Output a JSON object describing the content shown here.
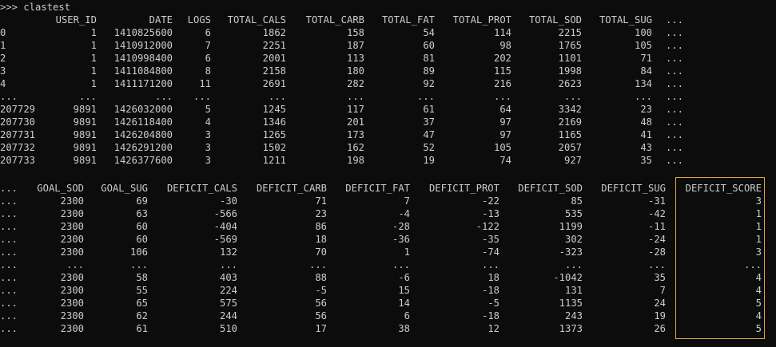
{
  "console": {
    "prompt_line": ">>> clastest",
    "highlight_color": "#e3a336",
    "block1": {
      "headers": [
        "",
        "USER_ID",
        "DATE",
        "LOGS",
        "TOTAL_CALS",
        "TOTAL_CARB",
        "TOTAL_FAT",
        "TOTAL_PROT",
        "TOTAL_SOD",
        "TOTAL_SUG",
        "..."
      ],
      "rows": [
        [
          "0",
          "1",
          "1410825600",
          "6",
          "1862",
          "158",
          "54",
          "114",
          "2215",
          "100",
          "..."
        ],
        [
          "1",
          "1",
          "1410912000",
          "7",
          "2251",
          "187",
          "60",
          "98",
          "1765",
          "105",
          "..."
        ],
        [
          "2",
          "1",
          "1410998400",
          "6",
          "2001",
          "113",
          "81",
          "202",
          "1101",
          "71",
          "..."
        ],
        [
          "3",
          "1",
          "1411084800",
          "8",
          "2158",
          "180",
          "89",
          "115",
          "1998",
          "84",
          "..."
        ],
        [
          "4",
          "1",
          "1411171200",
          "11",
          "2691",
          "282",
          "92",
          "216",
          "2623",
          "134",
          "..."
        ],
        [
          "...",
          "...",
          "...",
          "...",
          "...",
          "...",
          "...",
          "...",
          "...",
          "...",
          "..."
        ],
        [
          "207729",
          "9891",
          "1426032000",
          "5",
          "1245",
          "117",
          "61",
          "64",
          "3342",
          "23",
          "..."
        ],
        [
          "207730",
          "9891",
          "1426118400",
          "4",
          "1346",
          "201",
          "37",
          "97",
          "2169",
          "48",
          "..."
        ],
        [
          "207731",
          "9891",
          "1426204800",
          "3",
          "1265",
          "173",
          "47",
          "97",
          "1165",
          "41",
          "..."
        ],
        [
          "207732",
          "9891",
          "1426291200",
          "3",
          "1502",
          "162",
          "52",
          "105",
          "2057",
          "43",
          "..."
        ],
        [
          "207733",
          "9891",
          "1426377600",
          "3",
          "1211",
          "198",
          "19",
          "74",
          "927",
          "35",
          "..."
        ]
      ]
    },
    "block2": {
      "headers": [
        "...",
        "GOAL_SOD",
        "GOAL_SUG",
        "DEFICIT_CALS",
        "DEFICIT_CARB",
        "DEFICIT_FAT",
        "DEFICIT_PROT",
        "DEFICIT_SOD",
        "DEFICIT_SUG",
        "DEFICIT_SCORE"
      ],
      "rows": [
        [
          "...",
          "2300",
          "69",
          "-30",
          "71",
          "7",
          "-22",
          "85",
          "-31",
          "3"
        ],
        [
          "...",
          "2300",
          "63",
          "-566",
          "23",
          "-4",
          "-13",
          "535",
          "-42",
          "1"
        ],
        [
          "...",
          "2300",
          "60",
          "-404",
          "86",
          "-28",
          "-122",
          "1199",
          "-11",
          "1"
        ],
        [
          "...",
          "2300",
          "60",
          "-569",
          "18",
          "-36",
          "-35",
          "302",
          "-24",
          "1"
        ],
        [
          "...",
          "2300",
          "106",
          "132",
          "70",
          "1",
          "-74",
          "-323",
          "-28",
          "3"
        ],
        [
          "...",
          "...",
          "...",
          "...",
          "...",
          "...",
          "...",
          "...",
          "...",
          "..."
        ],
        [
          "...",
          "2300",
          "58",
          "403",
          "88",
          "-6",
          "18",
          "-1042",
          "35",
          "4"
        ],
        [
          "...",
          "2300",
          "55",
          "224",
          "-5",
          "15",
          "-18",
          "131",
          "7",
          "4"
        ],
        [
          "...",
          "2300",
          "65",
          "575",
          "56",
          "14",
          "-5",
          "1135",
          "24",
          "5"
        ],
        [
          "...",
          "2300",
          "62",
          "244",
          "56",
          "6",
          "-18",
          "243",
          "19",
          "4"
        ],
        [
          "...",
          "2300",
          "61",
          "510",
          "17",
          "38",
          "12",
          "1373",
          "26",
          "5"
        ]
      ]
    }
  }
}
